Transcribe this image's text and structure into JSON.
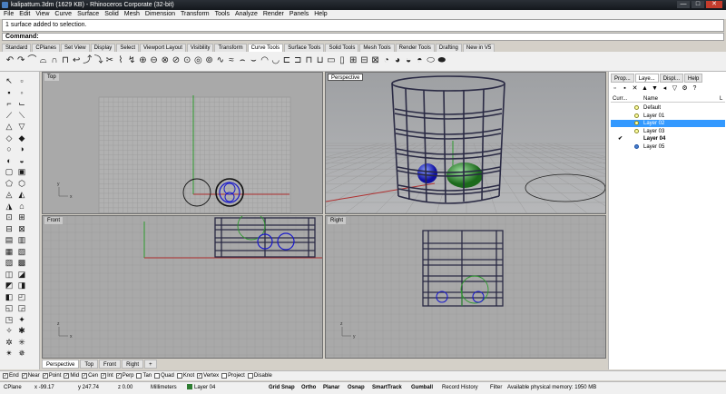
{
  "window": {
    "title": "kalipattum.3dm (1629 KB) - Rhinoceros Corporate (32-bit)",
    "controls": [
      "—",
      "□",
      "✕"
    ]
  },
  "menu": [
    "File",
    "Edit",
    "View",
    "Curve",
    "Surface",
    "Solid",
    "Mesh",
    "Dimension",
    "Transform",
    "Tools",
    "Analyze",
    "Render",
    "Panels",
    "Help"
  ],
  "command": {
    "history": "1 surface added to selection.",
    "prompt": "Command:"
  },
  "toolbar_tabs": [
    "Standard",
    "CPlanes",
    "Set View",
    "Display",
    "Select",
    "Viewport Layout",
    "Visibility",
    "Transform",
    "Curve Tools",
    "Surface Tools",
    "Solid Tools",
    "Mesh Tools",
    "Render Tools",
    "Drafting",
    "New in V5"
  ],
  "active_toolbar_tab": "Curve Tools",
  "viewports": {
    "top": "Top",
    "perspective": "Perspective",
    "front": "Front",
    "right": "Right",
    "axis_x": "x",
    "axis_y": "y",
    "axis_z": "z"
  },
  "viewport_tabs": [
    "Perspective",
    "Top",
    "Front",
    "Right",
    "+"
  ],
  "osnaps": [
    {
      "label": "End",
      "checked": true
    },
    {
      "label": "Near",
      "checked": true
    },
    {
      "label": "Point",
      "checked": true
    },
    {
      "label": "Mid",
      "checked": true
    },
    {
      "label": "Cen",
      "checked": true
    },
    {
      "label": "Int",
      "checked": true
    },
    {
      "label": "Perp",
      "checked": true
    },
    {
      "label": "Tan",
      "checked": false
    },
    {
      "label": "Quad",
      "checked": false
    },
    {
      "label": "Knot",
      "checked": false
    },
    {
      "label": "Vertex",
      "checked": true
    },
    {
      "label": "Project",
      "checked": false
    },
    {
      "label": "Disable",
      "checked": false
    }
  ],
  "status": {
    "cplane": "CPlane",
    "x": "x -99.17",
    "y": "y 247.74",
    "z": "z 0.00",
    "units": "Millimeters",
    "layer": "Layer 04",
    "grid_snap": "Grid Snap",
    "ortho": "Ortho",
    "planar": "Planar",
    "osnap": "Osnap",
    "smarttrack": "SmartTrack",
    "gumball": "Gumball",
    "record_history": "Record History",
    "filter": "Filter",
    "memory": "Available physical memory: 1950 MB"
  },
  "panel": {
    "tabs": [
      "Prop...",
      "Laye...",
      "Displ...",
      "Help"
    ],
    "col_current": "Curr...",
    "col_name": "Name",
    "col_l": "L",
    "layers": [
      {
        "name": "Default",
        "current": "",
        "selected": false,
        "bulb": "yellow"
      },
      {
        "name": "Layer 01",
        "current": "",
        "selected": false,
        "bulb": "yellow"
      },
      {
        "name": "Layer 02",
        "current": "",
        "selected": true,
        "bulb": "yellow"
      },
      {
        "name": "Layer 03",
        "current": "",
        "selected": false,
        "bulb": "yellow"
      },
      {
        "name": "Layer 04",
        "current": "✔",
        "selected": false,
        "bulb": "none"
      },
      {
        "name": "Layer 05",
        "current": "",
        "selected": false,
        "bulb": "blue"
      }
    ]
  },
  "colors": {
    "grid_bg": "#a9a9a9",
    "x_axis": "#b03030",
    "y_axis": "#2d9a2d",
    "object_blue": "#1a1acc",
    "cage_dark": "#2a2a44",
    "selection": "#3399ff"
  }
}
